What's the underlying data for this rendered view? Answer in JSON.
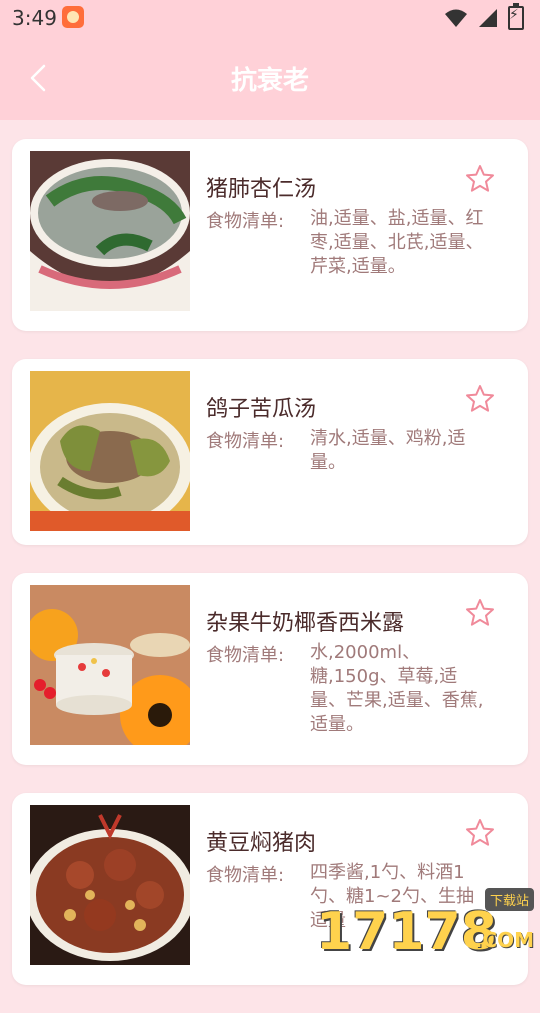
{
  "status_bar": {
    "time": "3:49",
    "icons": [
      "app-notification-icon",
      "wifi-icon",
      "signal-icon",
      "battery-charging-icon"
    ]
  },
  "header": {
    "title": "抗衰老",
    "back_icon": "chevron-left-icon"
  },
  "recipes": [
    {
      "name": "猪肺杏仁汤",
      "ingredients_label": "食物清单:",
      "ingredients": "油,适量、盐,适量、红枣,适量、北芪,适量、芹菜,适量。",
      "favorite_icon": "star-outline-icon",
      "thumbnail": "soup-bowl-with-greens"
    },
    {
      "name": "鸽子苦瓜汤",
      "ingredients_label": "食物清单:",
      "ingredients": "清水,适量、鸡粉,适量。",
      "favorite_icon": "star-outline-icon",
      "thumbnail": "pigeon-bitter-melon-soup"
    },
    {
      "name": "杂果牛奶椰香西米露",
      "ingredients_label": "食物清单:",
      "ingredients": "水,2000ml、糖,150g、草莓,适量、芒果,适量、香蕉,适量。",
      "favorite_icon": "star-outline-icon",
      "thumbnail": "sago-dessert-cup"
    },
    {
      "name": "黄豆焖猪肉",
      "ingredients_label": "食物清单:",
      "ingredients": "四季酱,1勺、料酒1勺、糖1~2勺、生抽适量",
      "favorite_icon": "star-outline-icon",
      "thumbnail": "braised-pork-soybeans"
    }
  ],
  "watermark": {
    "number": "17178",
    "badge": "下载站",
    "domain": ".COM"
  },
  "colors": {
    "header_bg": "#ffd1d8",
    "page_bg": "#fde4e8",
    "accent_pink": "#f08a9a",
    "title_text": "#4b2b2b",
    "body_text": "#a07a7a"
  }
}
